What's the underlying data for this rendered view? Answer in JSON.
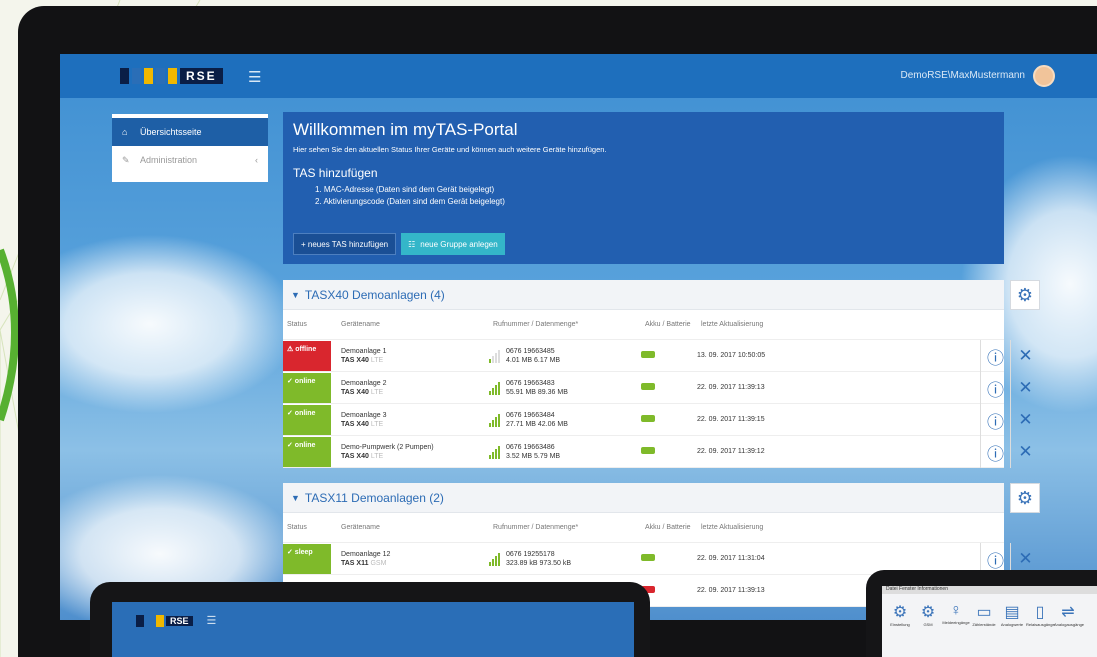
{
  "app": {
    "brand": "RSE",
    "user_name": "DemoRSE\\MaxMustermann"
  },
  "sidebar": {
    "items": [
      {
        "label": "Übersichtsseite",
        "active": true,
        "icon": "home-icon"
      },
      {
        "label": "Administration",
        "active": false,
        "icon": "wrench-icon"
      }
    ]
  },
  "welcome": {
    "title": "Willkommen im myTAS-Portal",
    "subtitle": "Hier sehen Sie den aktuellen Status Ihrer Geräte und können auch weitere Geräte hinzufügen.",
    "add_title": "TAS hinzufügen",
    "steps": [
      "1. MAC-Adresse (Daten sind dem Gerät beigelegt)",
      "2. Aktivierungscode (Daten sind dem Gerät beigelegt)"
    ],
    "btn_add": "+ neues TAS hinzufügen",
    "btn_group": "neue Gruppe anlegen"
  },
  "columns": {
    "status": "Status",
    "device": "Gerätename",
    "phone": "Rufnummer / Datenmenge*",
    "battery": "Akku / Batterie",
    "updated": "letzte Aktualisierung"
  },
  "groups": [
    {
      "title": "TASX40 Demoanlagen (4)",
      "rows": [
        {
          "status": "offline",
          "name": "Demoanlage 1",
          "model": "TAS X40",
          "conn": "LTE",
          "phone": "0676 19663485",
          "data": "4.01 MB  6.17 MB",
          "date": "13. 09. 2017 10:50:05",
          "signal": 1
        },
        {
          "status": "online",
          "name": "Demoanlage 2",
          "model": "TAS X40",
          "conn": "LTE",
          "phone": "0676 19663483",
          "data": "55.91 MB  89.36 MB",
          "date": "22. 09. 2017 11:39:13",
          "signal": 4
        },
        {
          "status": "online",
          "name": "Demoanlage 3",
          "model": "TAS X40",
          "conn": "LTE",
          "phone": "0676 19663484",
          "data": "27.71 MB  42.06 MB",
          "date": "22. 09. 2017 11:39:15",
          "signal": 4
        },
        {
          "status": "online",
          "name": "Demo-Pumpwerk (2 Pumpen)",
          "model": "TAS X40",
          "conn": "LTE",
          "phone": "0676 19663486",
          "data": "3.52 MB  5.79 MB",
          "date": "22. 09. 2017 11:39:12",
          "signal": 4
        }
      ]
    },
    {
      "title": "TASX11 Demoanlagen (2)",
      "rows": [
        {
          "status": "sleep",
          "name": "Demoanlage 12",
          "model": "TAS X11",
          "conn": "GSM",
          "phone": "0676 19255178",
          "data": "323.89 kB  973.50 kB",
          "date": "22. 09. 2017 11:31:04",
          "signal": 4
        },
        {
          "status": "",
          "name": "",
          "model": "",
          "conn": "",
          "phone": "",
          "data": "",
          "date": "22. 09. 2017 11:39:13",
          "signal": 0
        }
      ]
    }
  ],
  "colors": {
    "offline": "#d9262e",
    "online": "#7fba2a",
    "accent": "#225fb0"
  },
  "tablet_right": {
    "menu": "Datei  Fenster  Informationen",
    "icons": [
      "Einstellung",
      "GSM",
      "Meldeeingänge",
      "Zählerstände",
      "Analogwerte",
      "Relaisausgänge",
      "Analogausgänge"
    ]
  }
}
